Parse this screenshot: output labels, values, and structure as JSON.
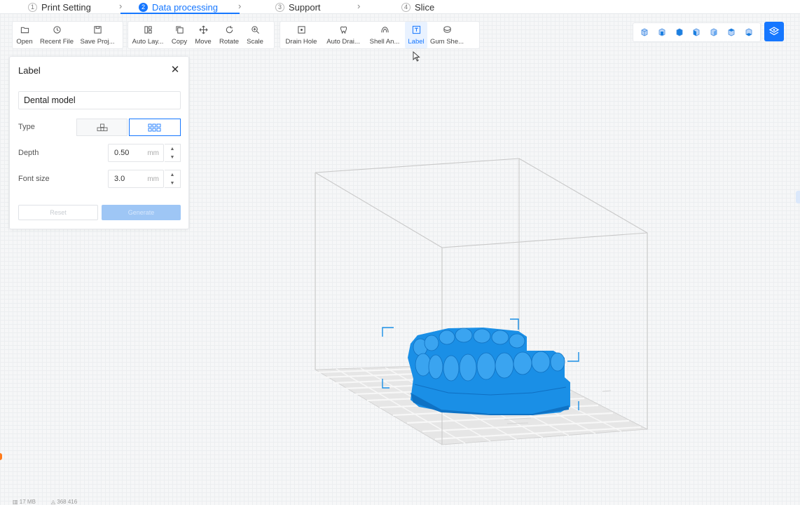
{
  "steps": [
    {
      "num": "1",
      "label": "Print Setting"
    },
    {
      "num": "2",
      "label": "Data processing"
    },
    {
      "num": "3",
      "label": "Support"
    },
    {
      "num": "4",
      "label": "Slice"
    }
  ],
  "toolbar": {
    "file": [
      "Open",
      "Recent File",
      "Save Proj..."
    ],
    "edit": [
      "Auto Lay...",
      "Copy",
      "Move",
      "Rotate",
      "Scale"
    ],
    "tools": [
      "Drain Hole",
      "Auto Drai...",
      "Shell An...",
      "Label",
      "Gum She..."
    ],
    "active_tool": "Label"
  },
  "view_icons": [
    "iso-view-icon",
    "front-view-icon",
    "back-view-icon",
    "left-view-icon",
    "right-view-icon",
    "top-view-icon",
    "bottom-view-icon"
  ],
  "panel": {
    "title": "Label",
    "text_value": "Dental model",
    "type_label": "Type",
    "depth_label": "Depth",
    "depth_value": "0.50",
    "depth_unit": "mm",
    "font_size_label": "Font size",
    "font_size_value": "3.0",
    "font_size_unit": "mm",
    "reset_label": "Reset",
    "generate_label": "Generate"
  },
  "status": {
    "memory": "17 MB",
    "triangles": "368 416"
  },
  "colors": {
    "accent": "#1677ff",
    "model": "#1a8fe6"
  }
}
